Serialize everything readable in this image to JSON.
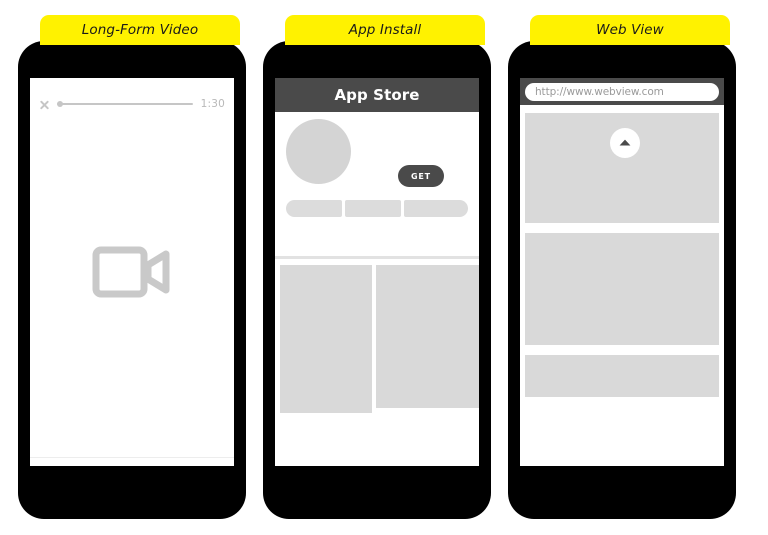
{
  "page": {
    "title": "Mobile Ad Format Wireframes",
    "background_color": "#ffffff",
    "tab_color": "#fff200",
    "frame_color": "#000000",
    "placeholder_gray": "#d9d9d9",
    "dark_ui_gray": "#4a4a4a"
  },
  "panels": [
    {
      "id": "long-form-video",
      "tab_label": "Long-Form Video",
      "screen": {
        "type": "video-player",
        "close_icon": "close-x-icon",
        "progress_value": 0,
        "progress_knob_position_percent": 0,
        "time_remaining": "1:30",
        "center_icon": "video-camera-icon"
      }
    },
    {
      "id": "app-install",
      "tab_label": "App Install",
      "screen": {
        "type": "app-store",
        "header_title": "App Store",
        "app_icon": "app-icon-placeholder",
        "install_button_label": "GET",
        "meta_segments": [
          "",
          "",
          ""
        ],
        "content_columns": [
          "",
          ""
        ]
      }
    },
    {
      "id": "web-view",
      "tab_label": "Web View",
      "screen": {
        "type": "browser",
        "url": "http://www.webview.com",
        "scroll_icon": "chevron-up-icon",
        "content_blocks": [
          "",
          "",
          ""
        ]
      }
    }
  ]
}
